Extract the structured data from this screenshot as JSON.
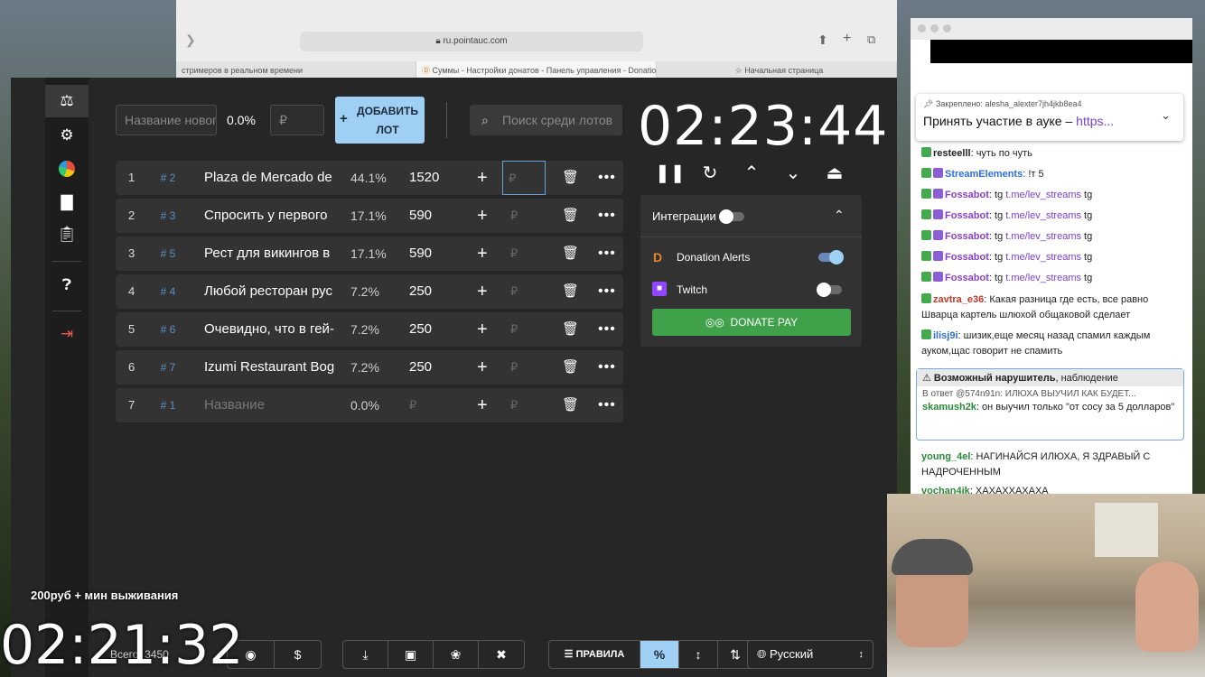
{
  "safari": {
    "url": "ru.pointauc.com",
    "tabs": [
      "стримеров в реальном времени",
      "Суммы - Настройки донатов - Панель управления - Donation...",
      "Начальная страница"
    ]
  },
  "new_lot": {
    "name_placeholder": "Название нового лота",
    "percent": "0.0%",
    "amount_placeholder": "₽",
    "add_label_1": "ДОБАВИТЬ",
    "add_label_2": "ЛОТ",
    "add_plus": "+"
  },
  "search": {
    "placeholder": "Поиск среди лотов"
  },
  "lots": [
    {
      "index": "1",
      "id": "# 2",
      "name": "Plaza de Mercado de",
      "percent": "44.1%",
      "amount": "1520",
      "plus": "+",
      "rub": "₽"
    },
    {
      "index": "2",
      "id": "# 3",
      "name": "Спросить у первого",
      "percent": "17.1%",
      "amount": "590",
      "plus": "+",
      "rub": "₽"
    },
    {
      "index": "3",
      "id": "# 5",
      "name": "Рест для викингов в",
      "percent": "17.1%",
      "amount": "590",
      "plus": "+",
      "rub": "₽"
    },
    {
      "index": "4",
      "id": "# 4",
      "name": "Любой ресторан рус",
      "percent": "7.2%",
      "amount": "250",
      "plus": "+",
      "rub": "₽"
    },
    {
      "index": "5",
      "id": "# 6",
      "name": "Очевидно, что в гей-",
      "percent": "7.2%",
      "amount": "250",
      "plus": "+",
      "rub": "₽"
    },
    {
      "index": "6",
      "id": "# 7",
      "name": "Izumi Restaurant Bogc",
      "percent": "7.2%",
      "amount": "250",
      "plus": "+",
      "rub": "₽"
    },
    {
      "index": "7",
      "id": "# 1",
      "name": "Название",
      "percent": "0.0%",
      "amount": "₽",
      "plus": "+",
      "rub": "₽"
    }
  ],
  "timer": {
    "value": "02:23:44"
  },
  "integrations": {
    "title": "Интеграции",
    "donation_alerts": "Donation Alerts",
    "twitch": "Twitch",
    "donate_pay": "DONATE PAY",
    "donation_alerts_enabled": true,
    "twitch_enabled": false,
    "integrations_enabled": false
  },
  "bottom": {
    "total": "Всего: 3450",
    "rules": "ПРАВИЛА",
    "percent_btn": "%",
    "language": "Русский",
    "currency": "$"
  },
  "overlay": {
    "caption": "200руб + мин выживания",
    "timer": "02:21:32"
  },
  "chat": {
    "pinned_label": "Закреплено:",
    "pinned_user": "alesha_alexter7jh4jkb8ea4",
    "pinned_text": "Принять участие в ауке –",
    "pinned_link": "https...",
    "messages": [
      {
        "user": "resteelll",
        "text": ": чуть по чуть",
        "color": "#222222"
      },
      {
        "user": "StreamElements",
        "text": ": !т 5",
        "color": "#2e6fd9"
      },
      {
        "user": "Fossabot",
        "text": ": tg ",
        "link": "t.me/lev_streams",
        "after": " tg",
        "color": "#8a3fd1"
      },
      {
        "user": "Fossabot",
        "text": ": tg ",
        "link": "t.me/lev_streams",
        "after": " tg",
        "color": "#8a3fd1"
      },
      {
        "user": "Fossabot",
        "text": ": tg ",
        "link": "t.me/lev_streams",
        "after": " tg",
        "color": "#8a3fd1"
      },
      {
        "user": "Fossabot",
        "text": ": tg ",
        "link": "t.me/lev_streams",
        "after": " tg",
        "color": "#8a3fd1"
      },
      {
        "user": "Fossabot",
        "text": ": tg ",
        "link": "t.me/lev_streams",
        "after": " tg",
        "color": "#8a3fd1"
      },
      {
        "user": "zavtra_e36",
        "text": ": Какая разница где есть, все равно Шварца картель шлюхой общаковой сделает",
        "color": "#c0392b"
      },
      {
        "user": "ilisj9i",
        "text": ": шизик,еще месяц назад спамил каждым ауком,щас говорит не спамить",
        "color": "#2e6fd9"
      }
    ],
    "violator_title": "Возможный нарушитель",
    "violator_suffix": ", наблюдение",
    "violator_reply": "В ответ @574n91n: ИЛЮХА ВЫУЧИЛ КАК БУДЕТ...",
    "violator_user": "skamush2k",
    "violator_text": ": он выучил только \"от сосу за 5 долларов\"",
    "msg_young_user": "young_4el",
    "msg_young_text": ": НАГИНАЙСЯ ИЛЮХА, Я ЗДРАВЫЙ С НАДРОЧЕННЫМ",
    "msg_last_user": "vochan4ik",
    "msg_last_text": ": ХАХАХХАХАХА"
  },
  "colors": {
    "accent": "#9fd0f3",
    "donate_pay": "#3fa24a",
    "app_bg": "#262626",
    "row_bg": "#333333"
  }
}
